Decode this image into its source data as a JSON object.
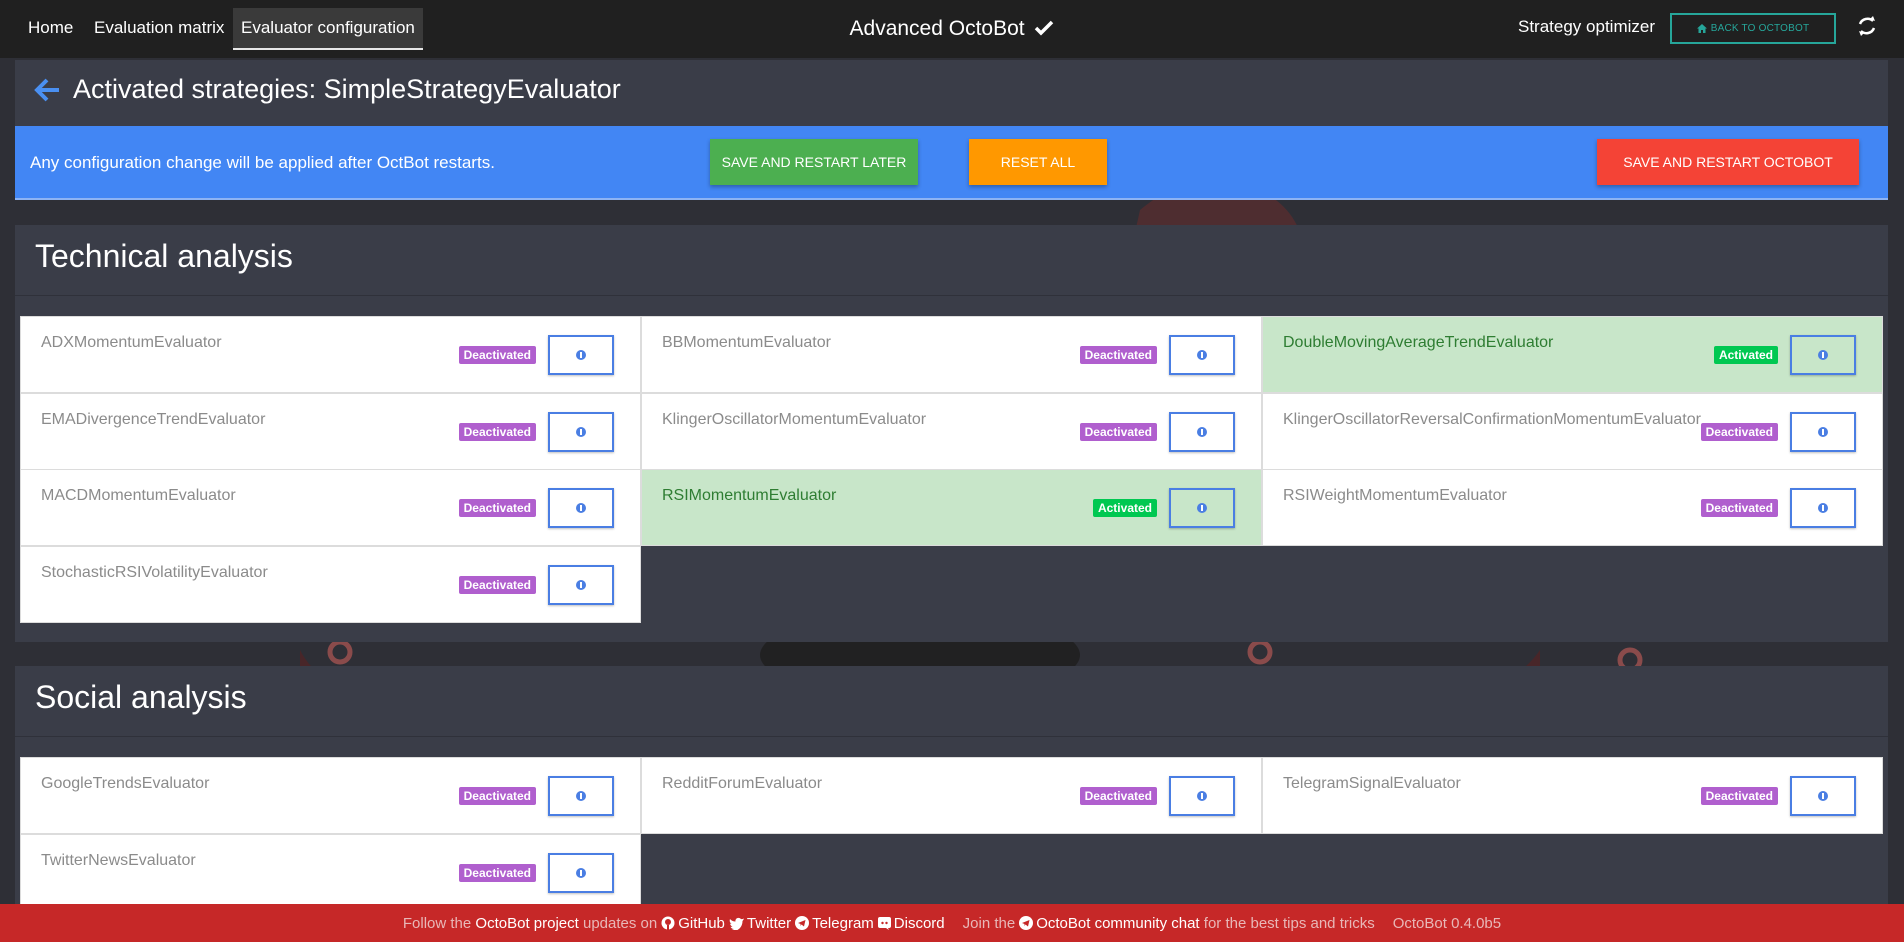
{
  "nav": {
    "links": [
      "Home",
      "Evaluation matrix",
      "Evaluator configuration"
    ],
    "brand": "Advanced OctoBot",
    "strategy_optimizer": "Strategy optimizer",
    "back_button": "Back to OctoBot",
    "icons": [
      "check-icon",
      "home-icon",
      "refresh-icon"
    ]
  },
  "header": {
    "title": "Activated strategies: SimpleStrategyEvaluator",
    "icon": "arrow-left-icon"
  },
  "alert": {
    "text": "Any configuration change will be applied after OctBot restarts.",
    "save_later": "Save and restart later",
    "reset_all": "Reset all",
    "save_restart": "Save and restart OctoBot"
  },
  "technical": {
    "title": "Technical analysis",
    "evaluators": [
      {
        "name": "ADXMomentumEvaluator",
        "status": "Deactivated"
      },
      {
        "name": "BBMomentumEvaluator",
        "status": "Deactivated"
      },
      {
        "name": "DoubleMovingAverageTrendEvaluator",
        "status": "Activated"
      },
      {
        "name": "EMADivergenceTrendEvaluator",
        "status": "Deactivated"
      },
      {
        "name": "KlingerOscillatorMomentumEvaluator",
        "status": "Deactivated"
      },
      {
        "name": "KlingerOscillatorReversalConfirmationMomentumEvaluator",
        "status": "Deactivated"
      },
      {
        "name": "MACDMomentumEvaluator",
        "status": "Deactivated"
      },
      {
        "name": "RSIMomentumEvaluator",
        "status": "Activated"
      },
      {
        "name": "RSIWeightMomentumEvaluator",
        "status": "Deactivated"
      },
      {
        "name": "StochasticRSIVolatilityEvaluator",
        "status": "Deactivated"
      }
    ]
  },
  "social": {
    "title": "Social analysis",
    "evaluators": [
      {
        "name": "GoogleTrendsEvaluator",
        "status": "Deactivated"
      },
      {
        "name": "RedditForumEvaluator",
        "status": "Deactivated"
      },
      {
        "name": "TelegramSignalEvaluator",
        "status": "Deactivated"
      },
      {
        "name": "TwitterNewsEvaluator",
        "status": "Deactivated"
      }
    ]
  },
  "footer": {
    "follow_the": "Follow the",
    "project": "OctoBot project",
    "updates_on": "updates on",
    "github": "GitHub",
    "twitter": "Twitter",
    "telegram": "Telegram",
    "discord": "Discord",
    "join_the": "Join the",
    "community": "OctoBot community chat",
    "tips": "for the best tips and tricks",
    "version": "OctoBot 0.4.0b5"
  },
  "colors": {
    "activated_bg": "#c8e6c9",
    "deactivated_badge": "#b05fce",
    "activated_badge": "#00c851",
    "alert_blue": "#4286f4",
    "footer_red": "#c62828"
  }
}
